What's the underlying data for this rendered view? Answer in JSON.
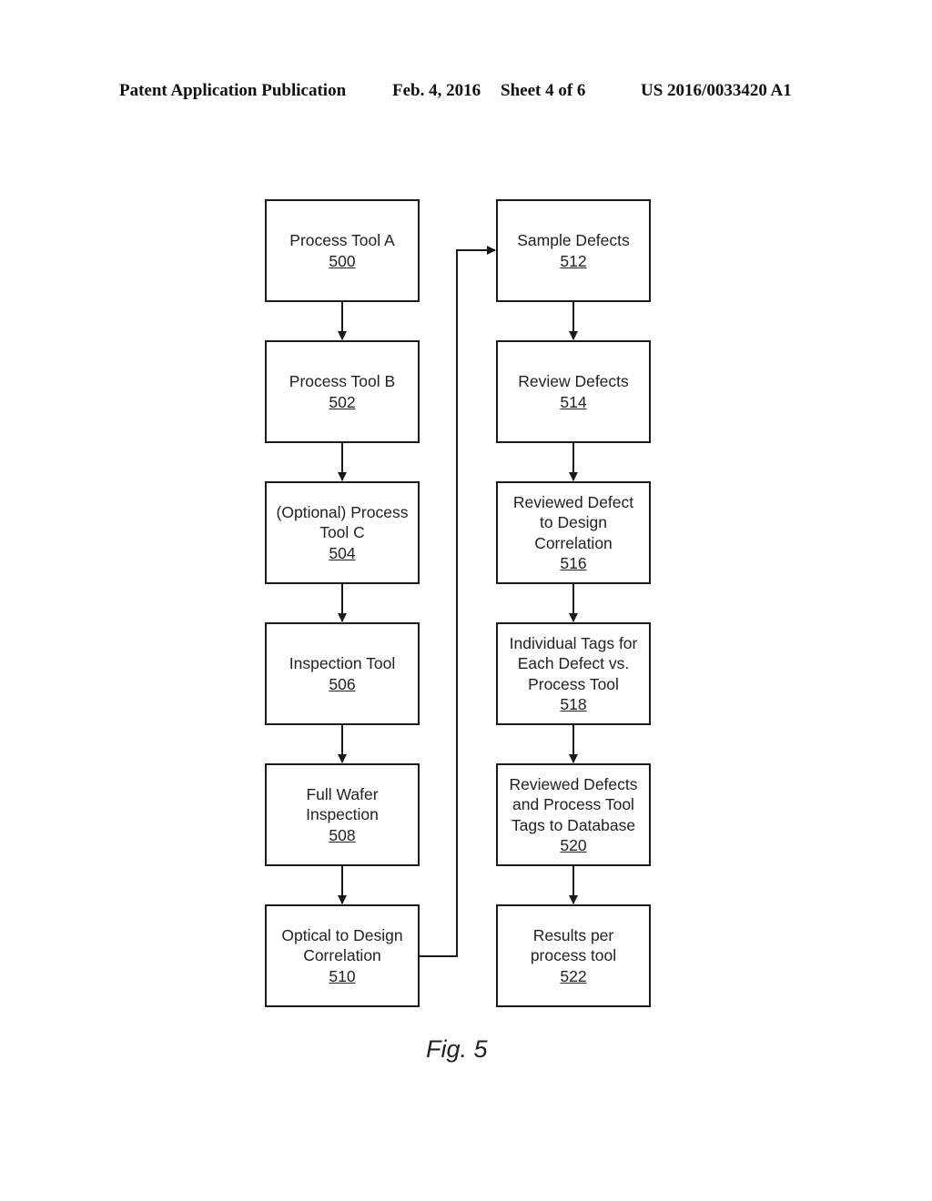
{
  "header": {
    "publication": "Patent Application Publication",
    "date": "Feb. 4, 2016",
    "sheet": "Sheet 4 of 6",
    "number": "US 2016/0033420 A1"
  },
  "left_column": [
    {
      "label": "Process Tool A",
      "ref": "500"
    },
    {
      "label": "Process Tool B",
      "ref": "502"
    },
    {
      "label": "(Optional) Process\nTool C",
      "ref": "504"
    },
    {
      "label": "Inspection Tool",
      "ref": "506"
    },
    {
      "label": "Full Wafer\nInspection",
      "ref": "508"
    },
    {
      "label": "Optical to Design\nCorrelation",
      "ref": "510"
    }
  ],
  "right_column": [
    {
      "label": "Sample Defects",
      "ref": "512"
    },
    {
      "label": "Review Defects",
      "ref": "514"
    },
    {
      "label": "Reviewed Defect\nto Design\nCorrelation",
      "ref": "516"
    },
    {
      "label": "Individual Tags for\nEach Defect vs.\nProcess Tool",
      "ref": "518"
    },
    {
      "label": "Reviewed Defects\nand Process Tool\nTags to Database",
      "ref": "520"
    },
    {
      "label": "Results per\nprocess tool",
      "ref": "522"
    }
  ],
  "figure_caption": "Fig. 5"
}
